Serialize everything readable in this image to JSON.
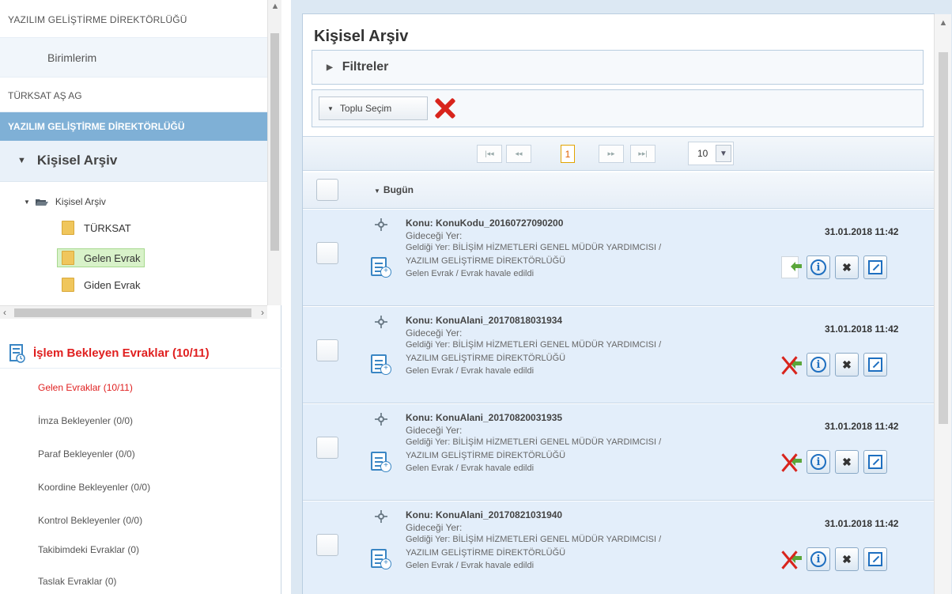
{
  "left": {
    "directorate": "YAZILIM GELİŞTİRME DİREKTÖRLÜĞÜ",
    "birimlerim": "Birimlerim",
    "turksat_ag": "TÜRKSAT AŞ AG",
    "selected_unit": "YAZILIM GELİŞTİRME DİREKTÖRLÜĞÜ",
    "kisisel_arsiv": "Kişisel Arşiv",
    "tree": {
      "root": "Kişisel Arşiv",
      "children": [
        "TÜRKSAT",
        "Gelen Evrak",
        "Giden Evrak"
      ]
    },
    "islem_title": "İşlem Bekleyen Evraklar (10/11)",
    "islem_items": [
      "Gelen Evraklar (10/11)",
      "İmza Bekleyenler (0/0)",
      "Paraf Bekleyenler (0/0)",
      "Koordine Bekleyenler (0/0)",
      "Kontrol Bekleyenler (0/0)",
      "Takibimdeki Evraklar (0)",
      "Taslak Evraklar (0)"
    ]
  },
  "main": {
    "title": "Kişisel Arşiv",
    "filters_label": "Filtreler",
    "bulk_select_label": "Toplu Seçim",
    "pager": {
      "first": "|◂◂",
      "prev": "◂◂",
      "page": "1",
      "next": "▸▸",
      "last": "▸▸|",
      "page_size": "10"
    },
    "group_label": "Bugün",
    "items": [
      {
        "konu": "Konu: KonuKodu_20160727090200",
        "gidecegi": "Gideceği Yer:",
        "geldigi1": "Geldiği Yer: BİLİŞİM HİZMETLERİ GENEL MÜDÜR YARDIMCISI /",
        "geldigi2": "YAZILIM GELİŞTİRME DİREKTÖRLÜĞÜ",
        "durum": "Gelen Evrak / Evrak havale edildi",
        "date": "31.01.2018 11:42"
      },
      {
        "konu": "Konu: KonuAlani_20170818031934",
        "gidecegi": "Gideceği Yer:",
        "geldigi1": "Geldiği Yer: BİLİŞİM HİZMETLERİ GENEL MÜDÜR YARDIMCISI /",
        "geldigi2": "YAZILIM GELİŞTİRME DİREKTÖRLÜĞÜ",
        "durum": "Gelen Evrak / Evrak havale edildi",
        "date": "31.01.2018 11:42"
      },
      {
        "konu": "Konu: KonuAlani_20170820031935",
        "gidecegi": "Gideceği Yer:",
        "geldigi1": "Geldiği Yer: BİLİŞİM HİZMETLERİ GENEL MÜDÜR YARDIMCISI /",
        "geldigi2": "YAZILIM GELİŞTİRME DİREKTÖRLÜĞÜ",
        "durum": "Gelen Evrak / Evrak havale edildi",
        "date": "31.01.2018 11:42"
      },
      {
        "konu": "Konu: KonuAlani_20170821031940",
        "gidecegi": "Gideceği Yer:",
        "geldigi1": "Geldiği Yer: BİLİŞİM HİZMETLERİ GENEL MÜDÜR YARDIMCISI /",
        "geldigi2": "YAZILIM GELİŞTİRME DİREKTÖRLÜĞÜ",
        "durum": "Gelen Evrak / Evrak havale edildi",
        "date": "31.01.2018 11:42"
      }
    ]
  }
}
